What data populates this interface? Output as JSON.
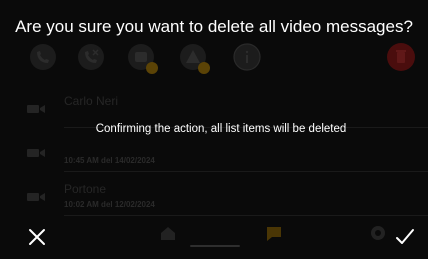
{
  "dialog": {
    "title": "Are you sure you want to delete all video messages?",
    "message": "Confirming the action, all list items will be deleted",
    "cancel_icon": "close-icon",
    "confirm_icon": "check-icon"
  },
  "background": {
    "toolbar_icons": [
      "phone-sound-icon",
      "phone-mute-icon",
      "video-message-icon",
      "alert-icon",
      "info-icon",
      "delete-icon"
    ],
    "list_items": [
      {
        "title": "Carlo Neri",
        "meta": ""
      },
      {
        "title": "",
        "meta": "10:45 AM del 14/02/2024"
      },
      {
        "title": "Portone",
        "meta": "10:02 AM del 12/02/2024"
      }
    ],
    "bottom_icons": [
      "home-icon",
      "message-icon",
      "settings-icon"
    ]
  },
  "colors": {
    "accent": "#5b4306",
    "danger": "#4a0d0d",
    "dim_icon": "#2c2c2c"
  }
}
